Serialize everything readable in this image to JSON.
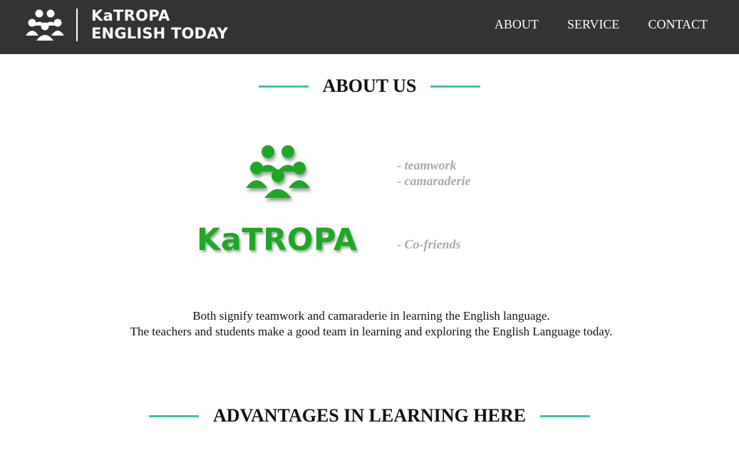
{
  "header": {
    "brand_line1": "KaTROPA",
    "brand_line2": "ENGLISH TODAY",
    "logo_icon": "people-group-icon",
    "background": "#333333",
    "nav": [
      {
        "label": "ABOUT"
      },
      {
        "label": "SERVICE"
      },
      {
        "label": "CONTACT"
      }
    ]
  },
  "about": {
    "title": "ABOUT US",
    "accent_color": "#3dc5a7",
    "brand_icon": "people-group-icon",
    "brand_word": "KaTROPA",
    "brand_color": "#1ea825",
    "meanings_group1": [
      "- teamwork",
      "- camaraderie"
    ],
    "meanings_group2": [
      "- Co-friends"
    ],
    "description": [
      "Both signify teamwork and camaraderie in learning the English language.",
      "The teachers and students make a good team in learning and exploring the English Language today."
    ]
  },
  "advantages": {
    "title": "ADVANTAGES IN LEARNING HERE"
  }
}
